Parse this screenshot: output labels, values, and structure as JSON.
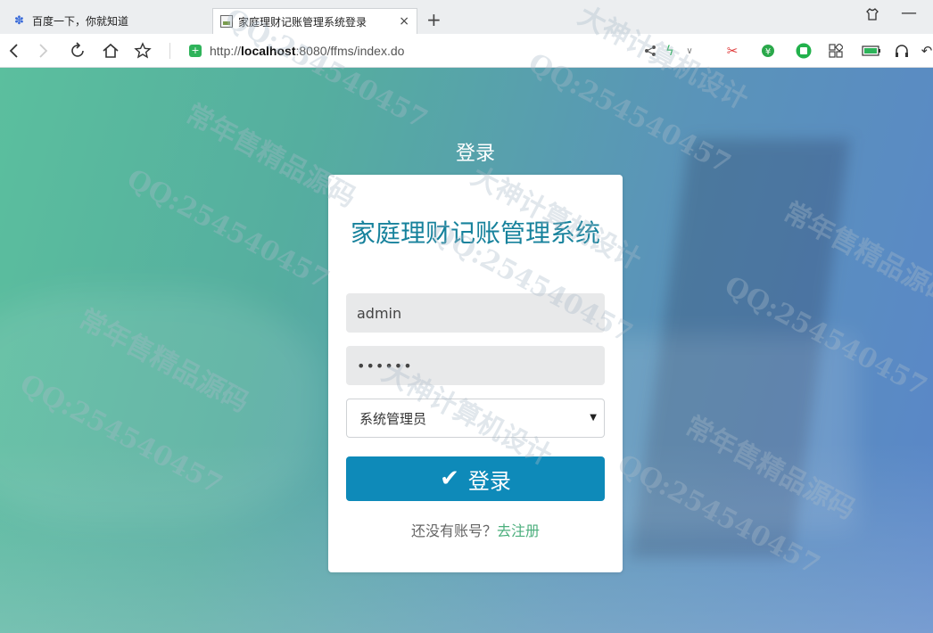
{
  "browser": {
    "tabs": [
      {
        "title": "百度一下，你就知道",
        "active": false,
        "icon": "baidu-paw-icon"
      },
      {
        "title": "家庭理财记账管理系统登录",
        "active": true,
        "icon": "page-icon",
        "close": "×"
      }
    ],
    "new_tab": "+",
    "url_prefix": "http://",
    "url_host": "localhost",
    "url_rest": ":8080/ffms/index.do"
  },
  "page": {
    "heading": "登录",
    "system_title": "家庭理财记账管理系统",
    "username_value": "admin",
    "password_value": "••••••",
    "role_selected": "系统管理员",
    "login_button": "登录",
    "register_prompt": "还没有账号？",
    "register_link": "去注册"
  },
  "watermarks": {
    "texts": [
      "QQ:254540457",
      "常年售精品源码",
      "大神计算机设计"
    ]
  },
  "colors": {
    "accent": "#0e8ab9",
    "title": "#17829c",
    "link": "#4caf7d",
    "background_start": "#5bbf9e",
    "background_end": "#5a86c9"
  }
}
